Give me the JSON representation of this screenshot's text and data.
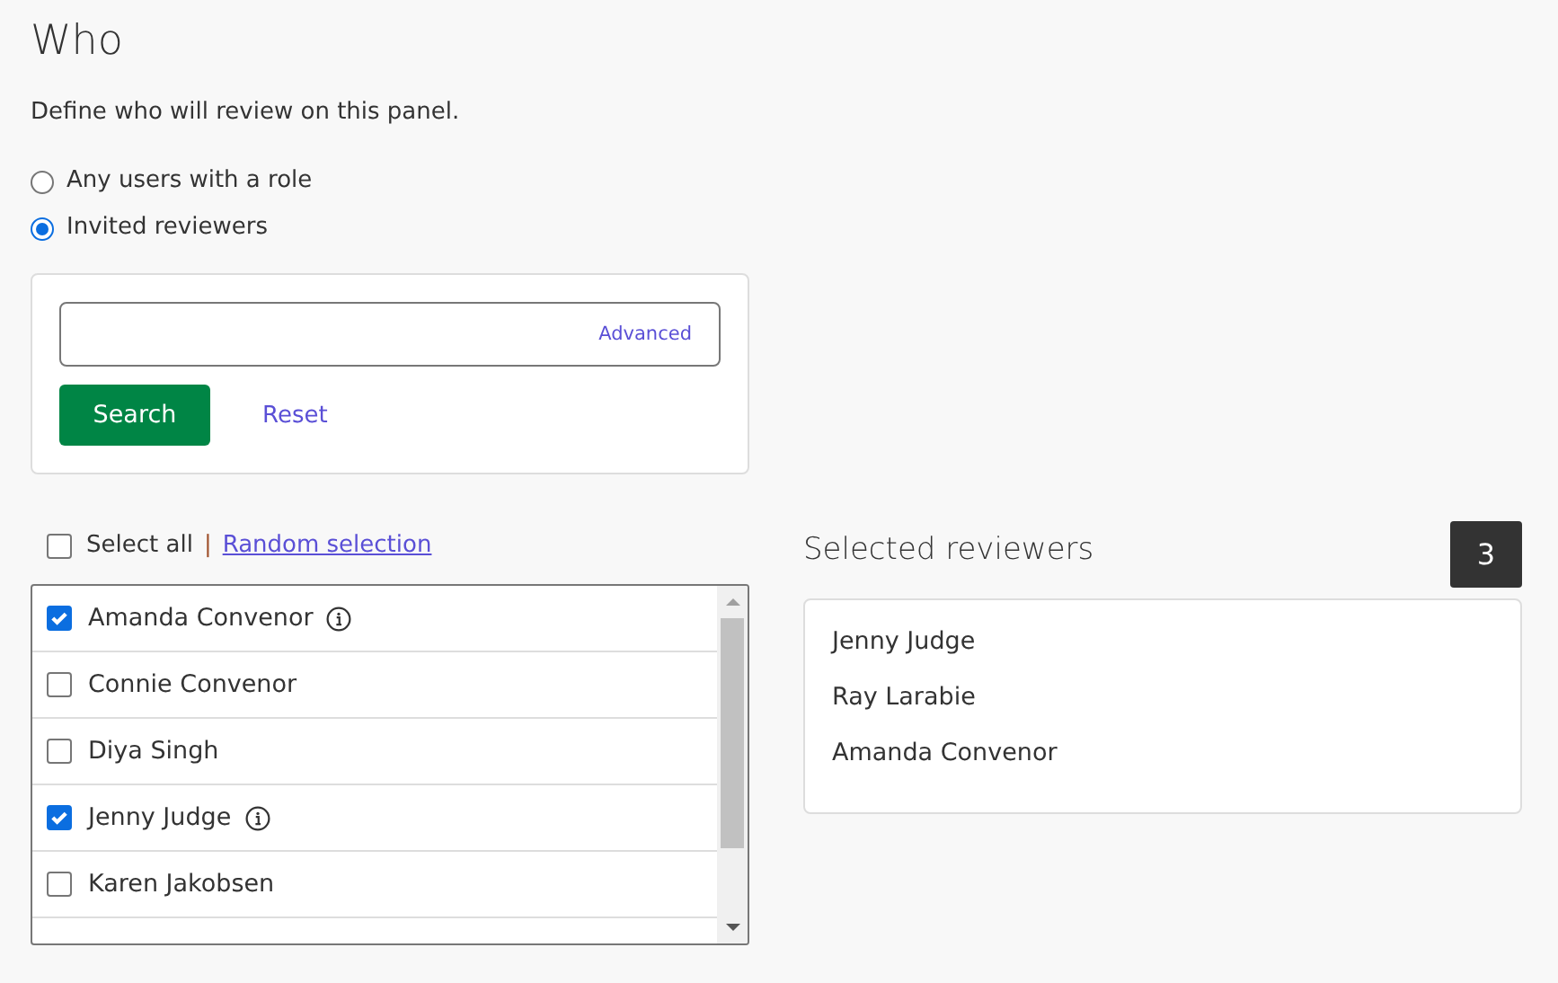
{
  "heading": "Who",
  "description": "Define who will review on this panel.",
  "options": [
    {
      "label": "Any users with a role",
      "selected": false
    },
    {
      "label": "Invited reviewers",
      "selected": true
    }
  ],
  "search": {
    "advanced_link": "Advanced",
    "search_button": "Search",
    "reset_link": "Reset"
  },
  "select_all": {
    "label": "Select all",
    "checked": false,
    "separator": "|",
    "random_link": "Random selection"
  },
  "users": [
    {
      "name": "Amanda Convenor",
      "checked": true,
      "info": true
    },
    {
      "name": "Connie Convenor",
      "checked": false,
      "info": false
    },
    {
      "name": "Diya Singh",
      "checked": false,
      "info": false
    },
    {
      "name": "Jenny Judge",
      "checked": true,
      "info": true
    },
    {
      "name": "Karen Jakobsen",
      "checked": false,
      "info": false
    }
  ],
  "selected_panel": {
    "title": "Selected reviewers",
    "count": "3",
    "reviewers": [
      "Jenny Judge",
      "Ray Larabie",
      "Amanda Convenor"
    ]
  }
}
